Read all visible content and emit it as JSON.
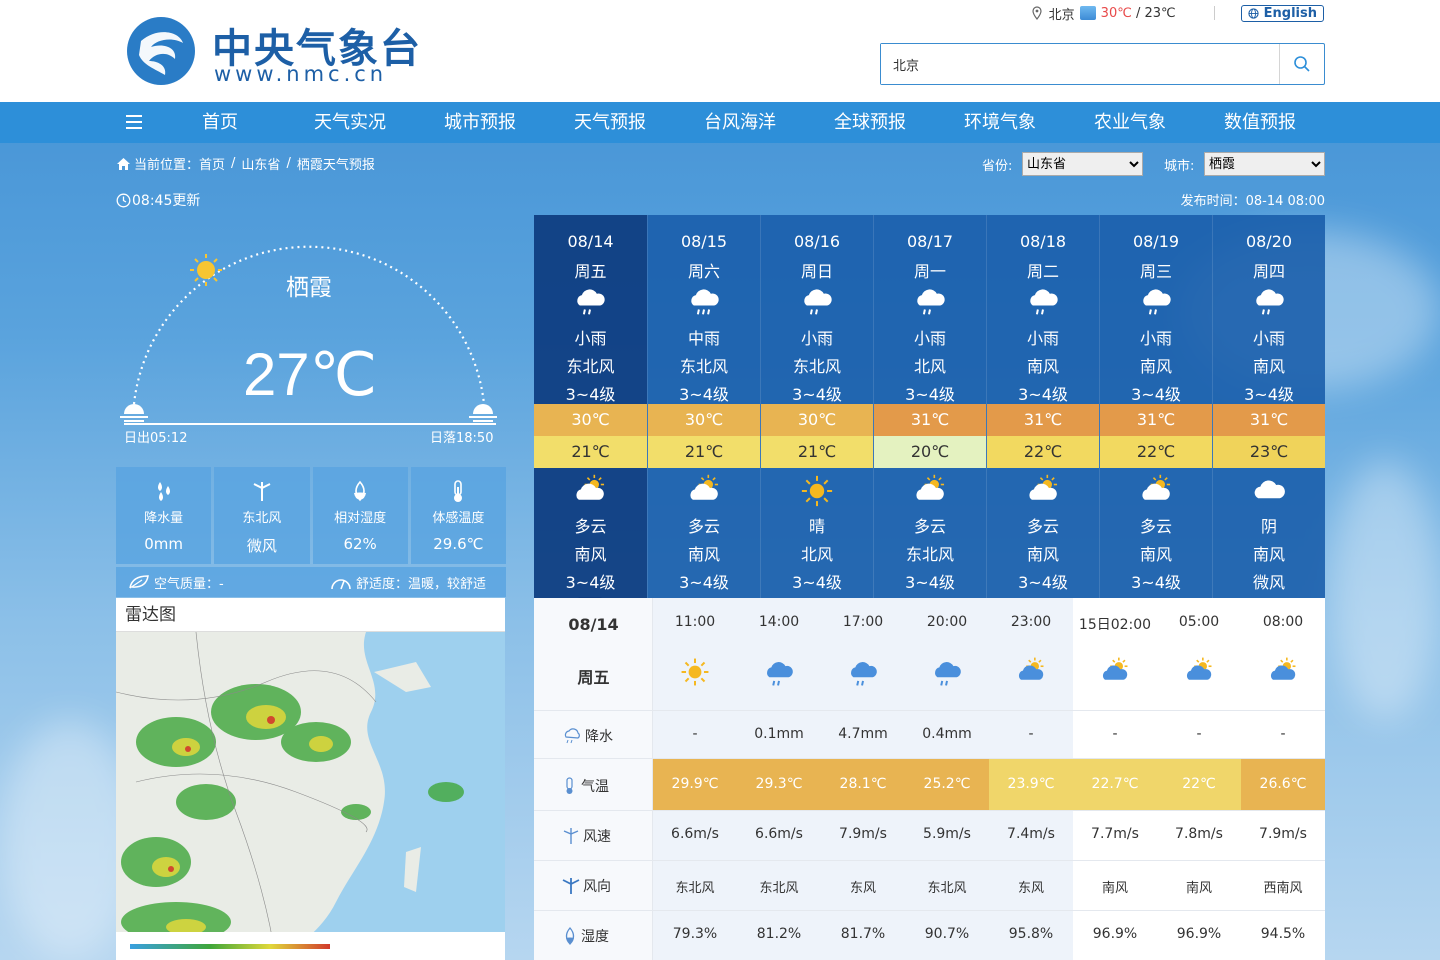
{
  "header": {
    "site_name": "中央气象台",
    "site_url": "www.nmc.cn",
    "location": "北京",
    "temp_hi": "30℃",
    "temp_sep": " / ",
    "temp_lo": "23℃",
    "english_label": "English"
  },
  "search": {
    "value": "北京",
    "placeholder": ""
  },
  "nav": [
    "首页",
    "天气实况",
    "城市预报",
    "天气预报",
    "台风海洋",
    "全球预报",
    "环境气象",
    "农业气象",
    "数值预报"
  ],
  "breadcrumb": {
    "prefix": "当前位置：",
    "items": [
      "首页",
      "/",
      "山东省",
      "/",
      "栖霞天气预报"
    ]
  },
  "selectors": {
    "province_label": "省份:",
    "province": "山东省",
    "city_label": "城市:",
    "city": "栖霞"
  },
  "update_time": "08:45更新",
  "publish_time": "发布时间：08-14 08:00",
  "current": {
    "city": "栖霞",
    "temp": "27℃",
    "sunrise": "日出05:12",
    "sunset": "日落18:50"
  },
  "stats": [
    {
      "icon": "raindrops-icon",
      "label": "降水量",
      "value": "0mm"
    },
    {
      "icon": "wind-turbine-icon",
      "label": "东北风",
      "value": "微风"
    },
    {
      "icon": "humidity-icon",
      "label": "相对湿度",
      "value": "62%"
    },
    {
      "icon": "thermometer-icon",
      "label": "体感温度",
      "value": "29.6℃"
    }
  ],
  "aqi": {
    "label": "空气质量：-",
    "comfort": "舒适度：温暖，较舒适"
  },
  "radar": {
    "title": "雷达图"
  },
  "colors": {
    "accent": "#2d8fd9",
    "hi_temp": "#e8a24e",
    "lo_temp": "#f0d66a"
  },
  "forecast": [
    {
      "date": "08/14",
      "week": "周五",
      "day_icon": "light-rain-icon",
      "day_weather": "小雨",
      "day_wind": "东北风",
      "day_level": "3~4级",
      "hi": "30℃",
      "lo": "21℃",
      "night_icon": "partly-cloudy-icon",
      "night_weather": "多云",
      "night_wind": "南风",
      "night_level": "3~4级",
      "hi_color": "#e8b452",
      "lo_color": "#f2de6a"
    },
    {
      "date": "08/15",
      "week": "周六",
      "day_icon": "moderate-rain-icon",
      "day_weather": "中雨",
      "day_wind": "东北风",
      "day_level": "3~4级",
      "hi": "30℃",
      "lo": "21℃",
      "night_icon": "partly-cloudy-icon",
      "night_weather": "多云",
      "night_wind": "南风",
      "night_level": "3~4级",
      "hi_color": "#e8b452",
      "lo_color": "#f2de6a"
    },
    {
      "date": "08/16",
      "week": "周日",
      "day_icon": "light-rain-icon",
      "day_weather": "小雨",
      "day_wind": "东北风",
      "day_level": "3~4级",
      "hi": "30℃",
      "lo": "21℃",
      "night_icon": "sun-icon",
      "night_weather": "晴",
      "night_wind": "北风",
      "night_level": "3~4级",
      "hi_color": "#e8b452",
      "lo_color": "#f2de6a"
    },
    {
      "date": "08/17",
      "week": "周一",
      "day_icon": "light-rain-icon",
      "day_weather": "小雨",
      "day_wind": "北风",
      "day_level": "3~4级",
      "hi": "31℃",
      "lo": "20℃",
      "night_icon": "partly-cloudy-icon",
      "night_weather": "多云",
      "night_wind": "东北风",
      "night_level": "3~4级",
      "hi_color": "#e39a4a",
      "lo_color": "#e4f2c0"
    },
    {
      "date": "08/18",
      "week": "周二",
      "day_icon": "light-rain-icon",
      "day_weather": "小雨",
      "day_wind": "南风",
      "day_level": "3~4级",
      "hi": "31℃",
      "lo": "22℃",
      "night_icon": "partly-cloudy-icon",
      "night_weather": "多云",
      "night_wind": "南风",
      "night_level": "3~4级",
      "hi_color": "#e39a4a",
      "lo_color": "#f2d960"
    },
    {
      "date": "08/19",
      "week": "周三",
      "day_icon": "light-rain-icon",
      "day_weather": "小雨",
      "day_wind": "南风",
      "day_level": "3~4级",
      "hi": "31℃",
      "lo": "22℃",
      "night_icon": "partly-cloudy-icon",
      "night_weather": "多云",
      "night_wind": "南风",
      "night_level": "3~4级",
      "hi_color": "#e39a4a",
      "lo_color": "#f2d960"
    },
    {
      "date": "08/20",
      "week": "周四",
      "day_icon": "light-rain-icon",
      "day_weather": "小雨",
      "day_wind": "南风",
      "day_level": "3~4级",
      "hi": "31℃",
      "lo": "23℃",
      "night_icon": "overcast-icon",
      "night_weather": "阴",
      "night_wind": "南风",
      "night_level": "微风",
      "hi_color": "#e39a4a",
      "lo_color": "#f0d35a"
    }
  ],
  "hourly": {
    "date": "08/14",
    "week": "周五",
    "row_labels": {
      "rain": "降水",
      "temp": "气温",
      "wind_speed": "风速",
      "wind_dir": "风向",
      "humidity": "湿度"
    },
    "hours": [
      {
        "time": "11:00",
        "icon": "sun-icon",
        "rain": "-",
        "temp": "29.9℃",
        "ws": "6.6m/s",
        "wd": "东北风",
        "hum": "79.3%",
        "color": "#e8b452"
      },
      {
        "time": "14:00",
        "icon": "rain-icon",
        "rain": "0.1mm",
        "temp": "29.3℃",
        "ws": "6.6m/s",
        "wd": "东北风",
        "hum": "81.2%",
        "color": "#e8b452"
      },
      {
        "time": "17:00",
        "icon": "rain-icon",
        "rain": "4.7mm",
        "temp": "28.1℃",
        "ws": "7.9m/s",
        "wd": "东风",
        "hum": "81.7%",
        "color": "#e8b452"
      },
      {
        "time": "20:00",
        "icon": "rain-icon",
        "rain": "0.4mm",
        "temp": "25.2℃",
        "ws": "5.9m/s",
        "wd": "东北风",
        "hum": "90.7%",
        "color": "#e8b452"
      },
      {
        "time": "23:00",
        "icon": "partly-cloudy-icon",
        "rain": "-",
        "temp": "23.9℃",
        "ws": "7.4m/s",
        "wd": "东风",
        "hum": "95.8%",
        "color": "#f0d66a"
      },
      {
        "time": "15日02:00",
        "icon": "partly-cloudy-icon",
        "rain": "-",
        "temp": "22.7℃",
        "ws": "7.7m/s",
        "wd": "南风",
        "hum": "96.9%",
        "color": "#f0d66a"
      },
      {
        "time": "05:00",
        "icon": "partly-cloudy-icon",
        "rain": "-",
        "temp": "22℃",
        "ws": "7.8m/s",
        "wd": "南风",
        "hum": "96.9%",
        "color": "#f0d66a"
      },
      {
        "time": "08:00",
        "icon": "partly-cloudy-icon",
        "rain": "-",
        "temp": "26.6℃",
        "ws": "7.9m/s",
        "wd": "西南风",
        "hum": "94.5%",
        "color": "#e8b452"
      }
    ]
  }
}
